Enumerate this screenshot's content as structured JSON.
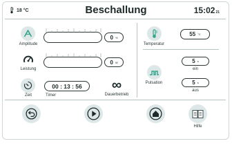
{
  "header": {
    "temperature": "18 °C",
    "title": "Beschallung",
    "time_main": "15:02",
    "time_seconds": "21"
  },
  "left_panel": {
    "amplitude": {
      "label": "Amplitude",
      "value": "0",
      "unit": "%"
    },
    "leistung": {
      "label": "Leistung",
      "value": "0",
      "unit": "W"
    },
    "zeit": {
      "label": "Zeit",
      "timer_value": "00 : 13 : 56",
      "timer_label": "Timer",
      "continuous_symbol": "∞",
      "continuous_label": "Dauerbetrieb"
    }
  },
  "right_panel": {
    "temperatur": {
      "label": "Temperatur",
      "value": "55",
      "unit": "°C"
    },
    "pulsation": {
      "label": "Pulsation",
      "on_value": "5",
      "on_unit": "s",
      "on_label": "ein",
      "off_value": "5",
      "off_unit": "s",
      "off_label": "aus"
    }
  },
  "footer": {
    "help_label": "Hilfe"
  },
  "colors": {
    "accent_green": "#2fa58a",
    "icon_bg": "#dde7e7",
    "dark": "#1e2a2a"
  }
}
